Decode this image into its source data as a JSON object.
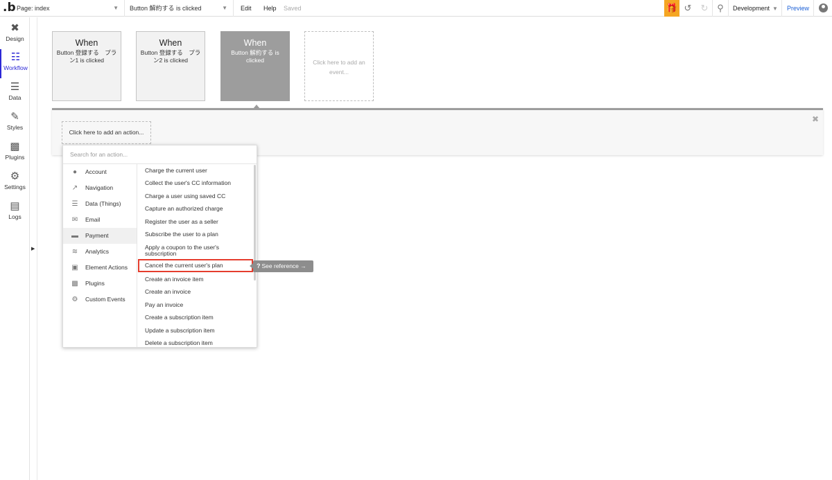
{
  "topbar": {
    "logo": ".b",
    "page_select": "Page: index",
    "event_select": "Button 解約する is clicked",
    "edit": "Edit",
    "help": "Help",
    "saved": "Saved",
    "gift_icon": "gift-icon",
    "environment": "Development",
    "preview": "Preview",
    "colors": {
      "gift_bg": "#f5a623",
      "preview": "#1a5fd6"
    }
  },
  "sidebar": {
    "items": [
      {
        "label": "Design",
        "icon": "design-tools-icon"
      },
      {
        "label": "Workflow",
        "icon": "workflow-icon"
      },
      {
        "label": "Data",
        "icon": "database-icon"
      },
      {
        "label": "Styles",
        "icon": "brush-icon"
      },
      {
        "label": "Plugins",
        "icon": "plugins-icon"
      },
      {
        "label": "Settings",
        "icon": "gear-icon"
      },
      {
        "label": "Logs",
        "icon": "logs-icon"
      }
    ],
    "active_color": "#2c28d6"
  },
  "events": [
    {
      "when": "When",
      "desc": "Button 登録する　プラン1 is clicked"
    },
    {
      "when": "When",
      "desc": "Button 登録する　プラン2 is clicked"
    },
    {
      "when": "When",
      "desc": "Button 解約する is clicked"
    },
    {
      "desc": "Click here to add an event..."
    }
  ],
  "workflow": {
    "add_action": "Click here to add an action..."
  },
  "dropdown": {
    "search_placeholder": "Search for an action...",
    "categories": [
      {
        "label": "Account",
        "icon": "account-icon"
      },
      {
        "label": "Navigation",
        "icon": "navigation-icon"
      },
      {
        "label": "Data (Things)",
        "icon": "database-icon"
      },
      {
        "label": "Email",
        "icon": "email-icon"
      },
      {
        "label": "Payment",
        "icon": "payment-card-icon"
      },
      {
        "label": "Analytics",
        "icon": "analytics-icon"
      },
      {
        "label": "Element Actions",
        "icon": "element-actions-icon"
      },
      {
        "label": "Plugins",
        "icon": "plugins-icon"
      },
      {
        "label": "Custom Events",
        "icon": "custom-events-icon"
      }
    ],
    "selected_category": "Payment",
    "actions": [
      "Charge the current user",
      "Collect the user's CC information",
      "Charge a user using saved CC",
      "Capture an authorized charge",
      "Register the user as a seller",
      "Subscribe the user to a plan",
      "Apply a coupon to the user's subscription",
      "Cancel the current user's plan",
      "Create an invoice item",
      "Create an invoice",
      "Pay an invoice",
      "Create a subscription item",
      "Update a subscription item",
      "Delete a subscription item"
    ],
    "highlighted_action": "Cancel the current user's plan",
    "highlight_color": "#e53d2d",
    "see_reference": "See reference →",
    "see_reference_icon": "?"
  }
}
